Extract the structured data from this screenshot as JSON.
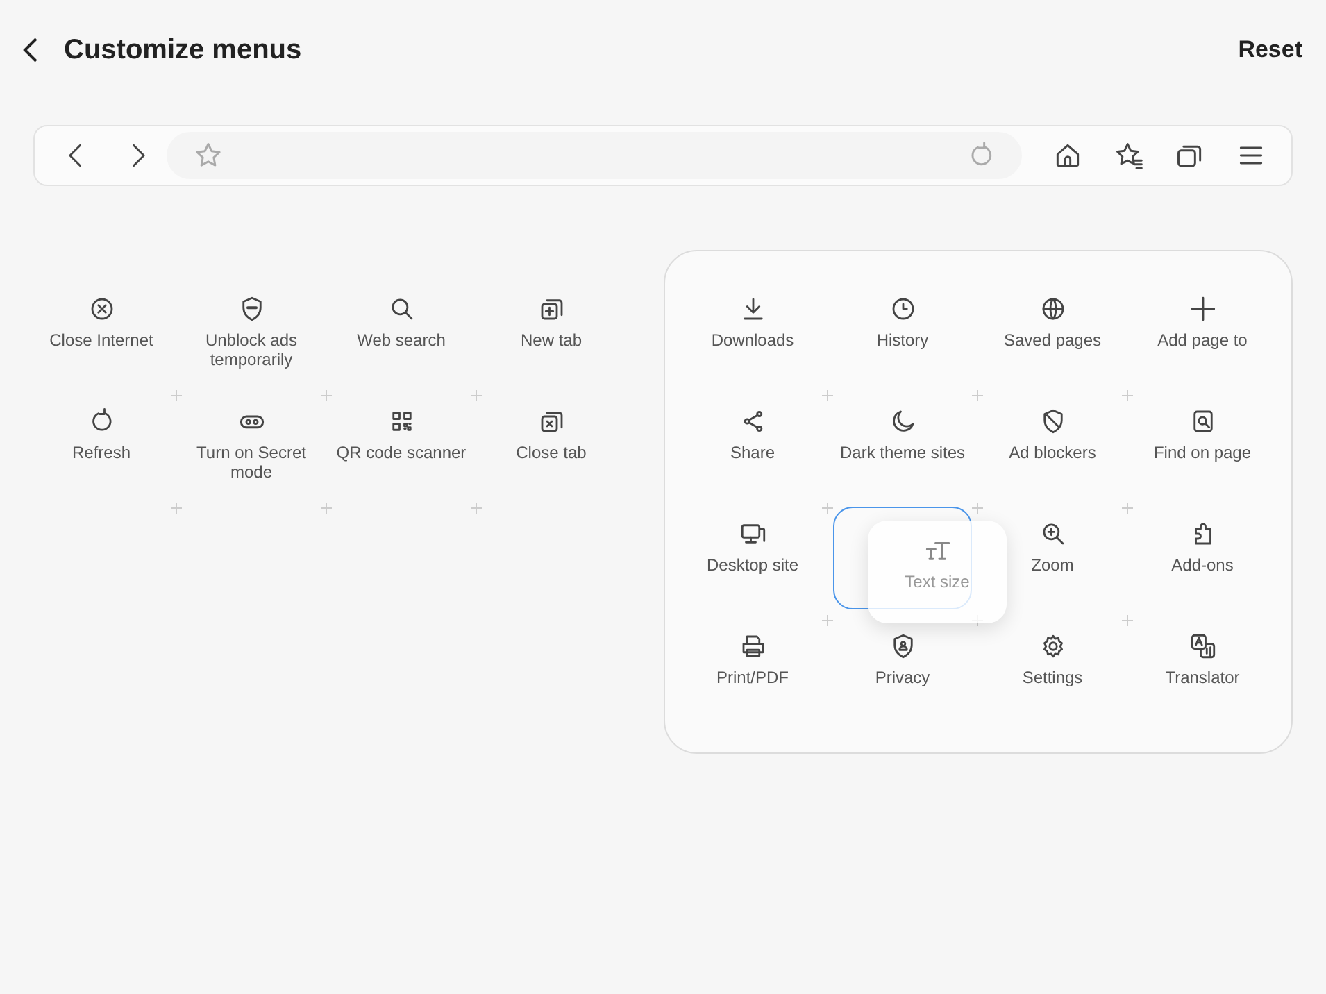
{
  "header": {
    "title": "Customize menus",
    "action": "Reset"
  },
  "available_items": [
    {
      "label": "Close Internet"
    },
    {
      "label": "Unblock ads temporarily"
    },
    {
      "label": "Web search"
    },
    {
      "label": "New tab"
    },
    {
      "label": "Refresh"
    },
    {
      "label": "Turn on Secret mode"
    },
    {
      "label": "QR code scanner"
    },
    {
      "label": "Close tab"
    }
  ],
  "menu_items": [
    {
      "kind": "item",
      "label": "Downloads"
    },
    {
      "kind": "item",
      "label": "History"
    },
    {
      "kind": "item",
      "label": "Saved pages"
    },
    {
      "kind": "item",
      "label": "Add page to"
    },
    {
      "kind": "item",
      "label": "Share"
    },
    {
      "kind": "item",
      "label": "Dark theme sites"
    },
    {
      "kind": "item",
      "label": "Ad blockers"
    },
    {
      "kind": "item",
      "label": "Find on page"
    },
    {
      "kind": "item",
      "label": "Desktop site"
    },
    {
      "kind": "drop-target"
    },
    {
      "kind": "item",
      "label": "Zoom"
    },
    {
      "kind": "item",
      "label": "Add-ons"
    },
    {
      "kind": "item",
      "label": "Print/PDF"
    },
    {
      "kind": "item",
      "label": "Privacy"
    },
    {
      "kind": "item",
      "label": "Settings"
    },
    {
      "kind": "item",
      "label": "Translator"
    }
  ],
  "dragged_item": {
    "label": "Text size"
  }
}
